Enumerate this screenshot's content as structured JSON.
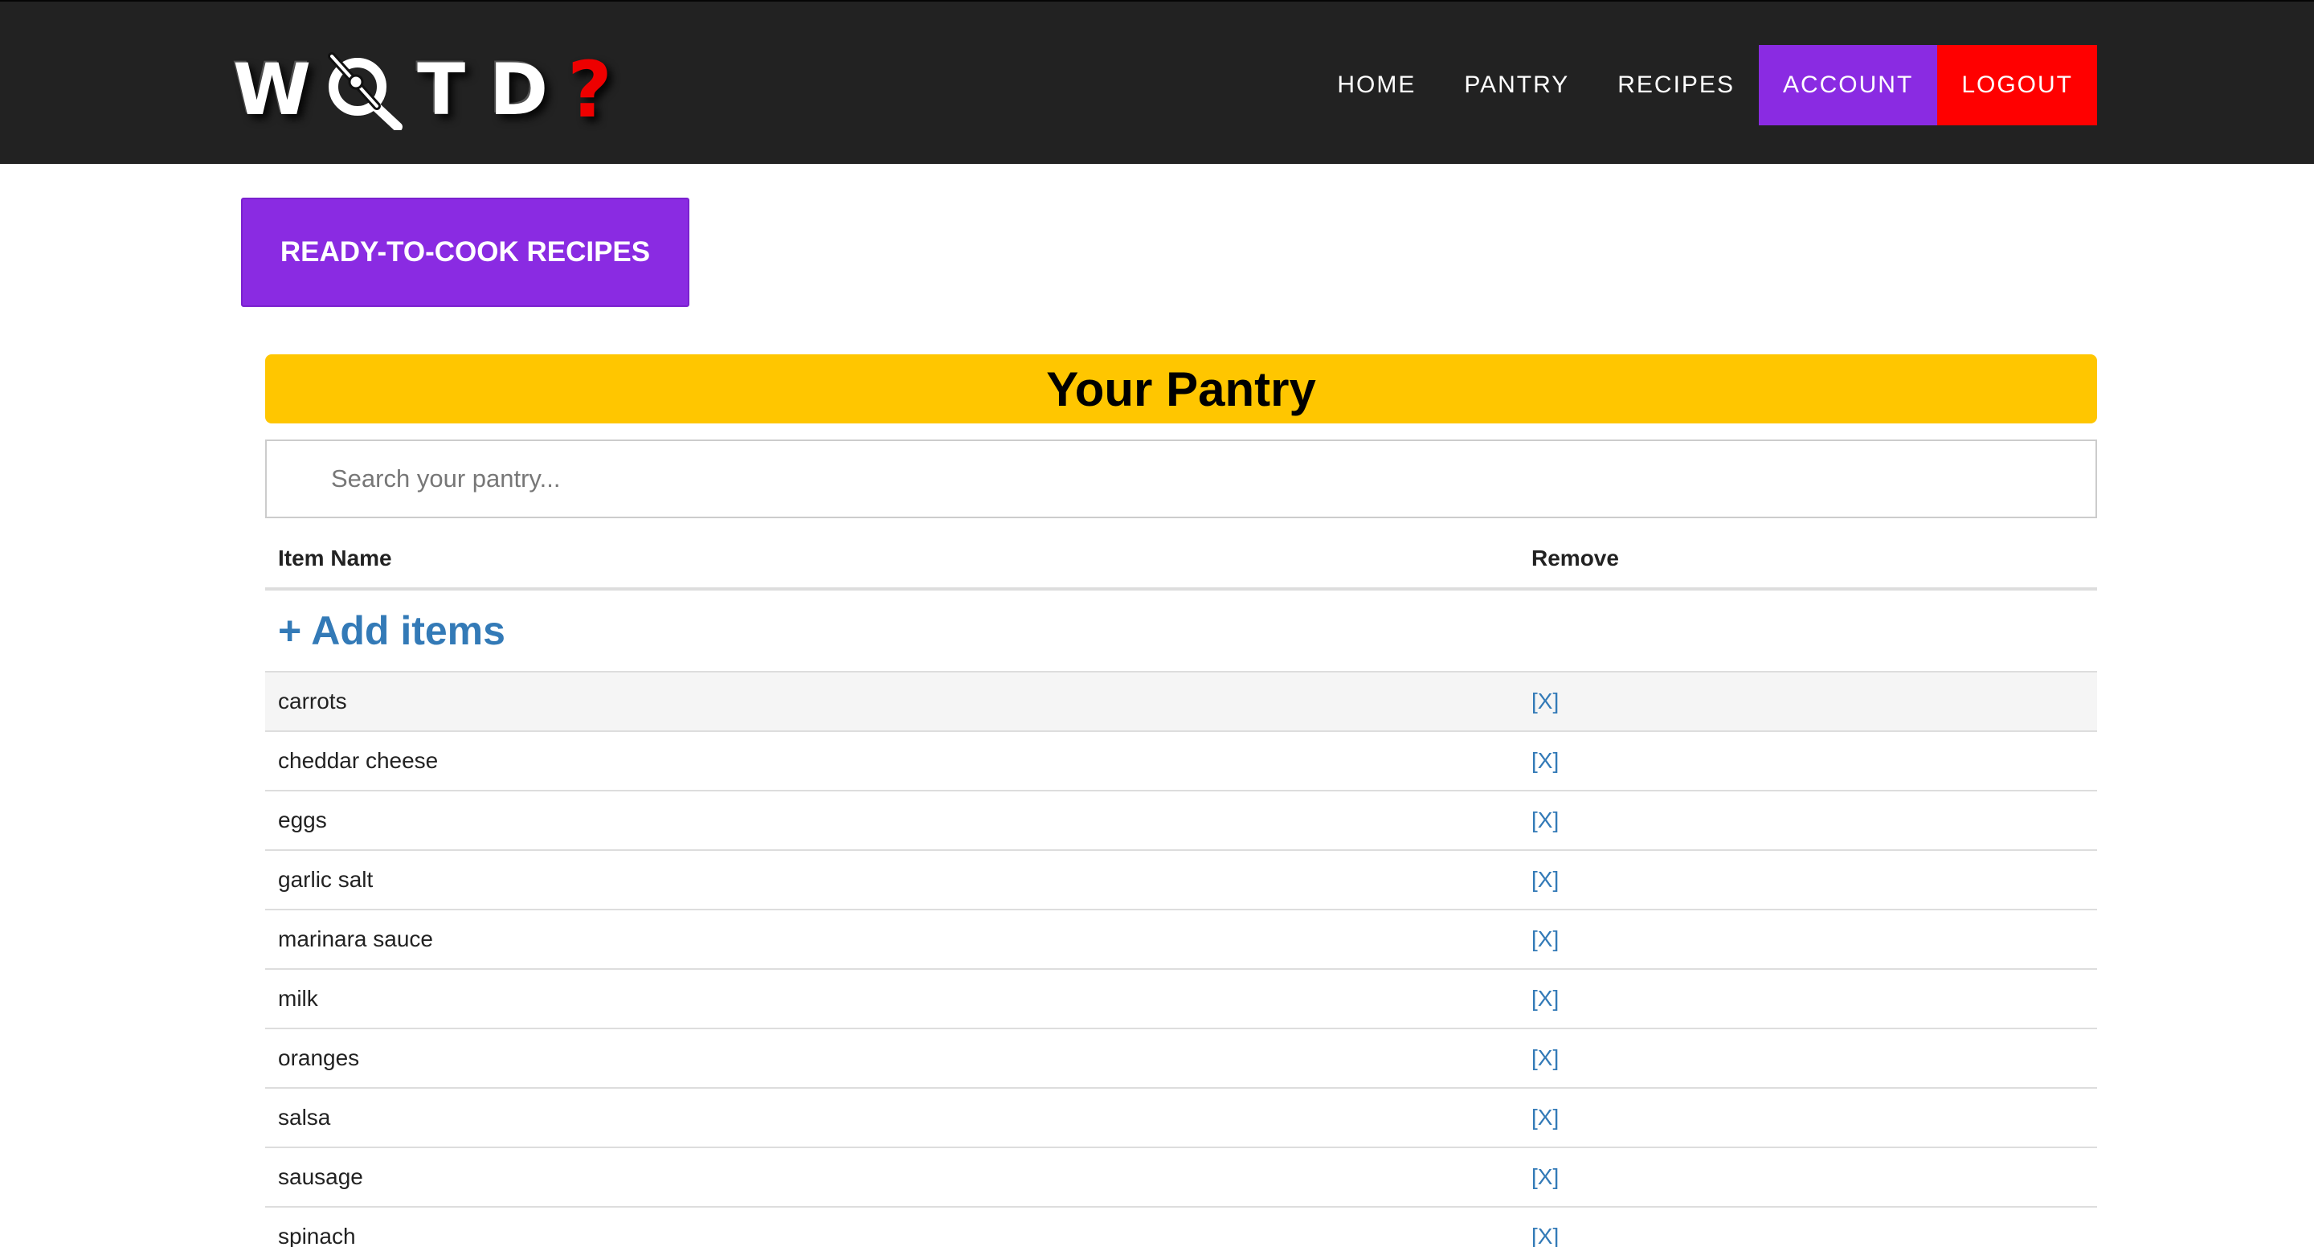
{
  "logo": {
    "letters_left": "W",
    "letters_right": [
      "T",
      "D"
    ],
    "mark": "?",
    "q_icon": "whisk-magnifier-icon"
  },
  "nav": {
    "home": "HOME",
    "pantry": "PANTRY",
    "recipes": "RECIPES",
    "account": "ACCOUNT",
    "logout": "LOGOUT"
  },
  "ready_button": "READY-TO-COOK RECIPES",
  "pantry": {
    "title": "Your Pantry",
    "search_placeholder": "Search your pantry...",
    "columns": {
      "name": "Item Name",
      "remove": "Remove"
    },
    "add_items": "+ Add items",
    "remove_label": "[X]",
    "items": [
      "carrots",
      "cheddar cheese",
      "eggs",
      "garlic salt",
      "marinara sauce",
      "milk",
      "oranges",
      "salsa",
      "sausage",
      "spinach"
    ]
  },
  "colors": {
    "navbar": "#222222",
    "accent_purple": "#8a2be2",
    "logout_red": "#ff0000",
    "title_yellow": "#ffc600",
    "link_blue": "#337ab7"
  }
}
